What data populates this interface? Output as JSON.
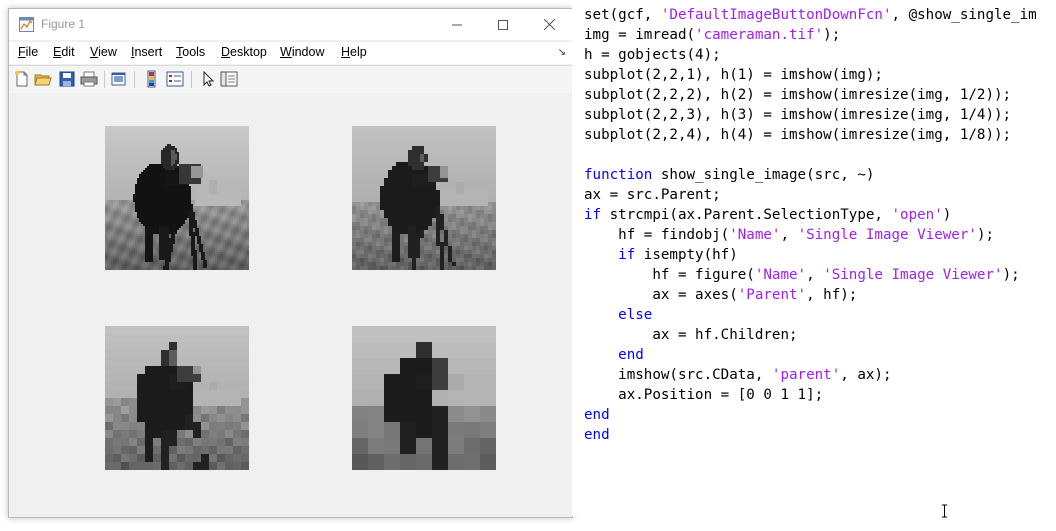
{
  "figure_window": {
    "title": "Figure 1",
    "menu": [
      "File",
      "Edit",
      "View",
      "Insert",
      "Tools",
      "Desktop",
      "Window",
      "Help"
    ],
    "menu_mnemonics": [
      "F",
      "E",
      "V",
      "I",
      "T",
      "D",
      "W",
      "H"
    ],
    "toolbar_icons": [
      "new-figure-icon",
      "open-file-icon",
      "save-icon",
      "print-icon",
      "print-preview-icon",
      "colorbar-icon",
      "legend-icon",
      "edit-plot-arrow-icon",
      "property-inspector-icon"
    ],
    "subplots": [
      {
        "label": "subplot(2,2,1) imshow(img)",
        "scale": 1
      },
      {
        "label": "subplot(2,2,2) imshow(imresize(img,1/2))",
        "scale": 0.5
      },
      {
        "label": "subplot(2,2,3) imshow(imresize(img,1/4))",
        "scale": 0.25
      },
      {
        "label": "subplot(2,2,4) imshow(imresize(img,1/8))",
        "scale": 0.125
      }
    ]
  },
  "editor": {
    "lines": [
      [
        [
          "set(gcf, ",
          "plain"
        ],
        [
          "'DefaultImageButtonDownFcn'",
          "str"
        ],
        [
          ", @show_single_im",
          "plain"
        ]
      ],
      [
        [
          "img = imread(",
          "plain"
        ],
        [
          "'cameraman.tif'",
          "str"
        ],
        [
          ");",
          "plain"
        ]
      ],
      [
        [
          "h = gobjects(4);",
          "plain"
        ]
      ],
      [
        [
          "subplot(2,2,1), h(1) = imshow(img);",
          "plain"
        ]
      ],
      [
        [
          "subplot(2,2,2), h(2) = imshow(imresize(img, 1/2));",
          "plain"
        ]
      ],
      [
        [
          "subplot(2,2,3), h(3) = imshow(imresize(img, 1/4));",
          "plain"
        ]
      ],
      [
        [
          "subplot(2,2,4), h(4) = imshow(imresize(img, 1/8));",
          "plain"
        ]
      ],
      [
        [
          "",
          "plain"
        ]
      ],
      [
        [
          "function",
          "kw"
        ],
        [
          " show_single_image(src, ~)",
          "plain"
        ]
      ],
      [
        [
          "ax = src.Parent;",
          "plain"
        ]
      ],
      [
        [
          "if",
          "kw"
        ],
        [
          " strcmpi(ax.Parent.SelectionType, ",
          "plain"
        ],
        [
          "'open'",
          "str"
        ],
        [
          ")",
          "plain"
        ]
      ],
      [
        [
          "    hf = findobj(",
          "plain"
        ],
        [
          "'Name'",
          "str"
        ],
        [
          ", ",
          "plain"
        ],
        [
          "'Single Image Viewer'",
          "str"
        ],
        [
          ");",
          "plain"
        ]
      ],
      [
        [
          "    ",
          "plain"
        ],
        [
          "if",
          "kw"
        ],
        [
          " isempty(hf)",
          "plain"
        ]
      ],
      [
        [
          "        hf = figure(",
          "plain"
        ],
        [
          "'Name'",
          "str"
        ],
        [
          ", ",
          "plain"
        ],
        [
          "'Single Image Viewer'",
          "str"
        ],
        [
          ");",
          "plain"
        ]
      ],
      [
        [
          "        ax = axes(",
          "plain"
        ],
        [
          "'Parent'",
          "str"
        ],
        [
          ", hf);",
          "plain"
        ]
      ],
      [
        [
          "    ",
          "plain"
        ],
        [
          "else",
          "kw"
        ]
      ],
      [
        [
          "        ax = hf.Children;",
          "plain"
        ]
      ],
      [
        [
          "    ",
          "plain"
        ],
        [
          "end",
          "kw"
        ]
      ],
      [
        [
          "    imshow(src.CData, ",
          "plain"
        ],
        [
          "'parent'",
          "str"
        ],
        [
          ", ax);",
          "plain"
        ]
      ],
      [
        [
          "    ax.Position = [0 0 1 1];",
          "plain"
        ]
      ],
      [
        [
          "end",
          "kw"
        ]
      ],
      [
        [
          "end",
          "kw"
        ]
      ]
    ]
  },
  "colors": {
    "keyword": "#0000ff",
    "string": "#a020f0",
    "figure_bg": "#f0f0f0",
    "title_text": "#999999"
  }
}
